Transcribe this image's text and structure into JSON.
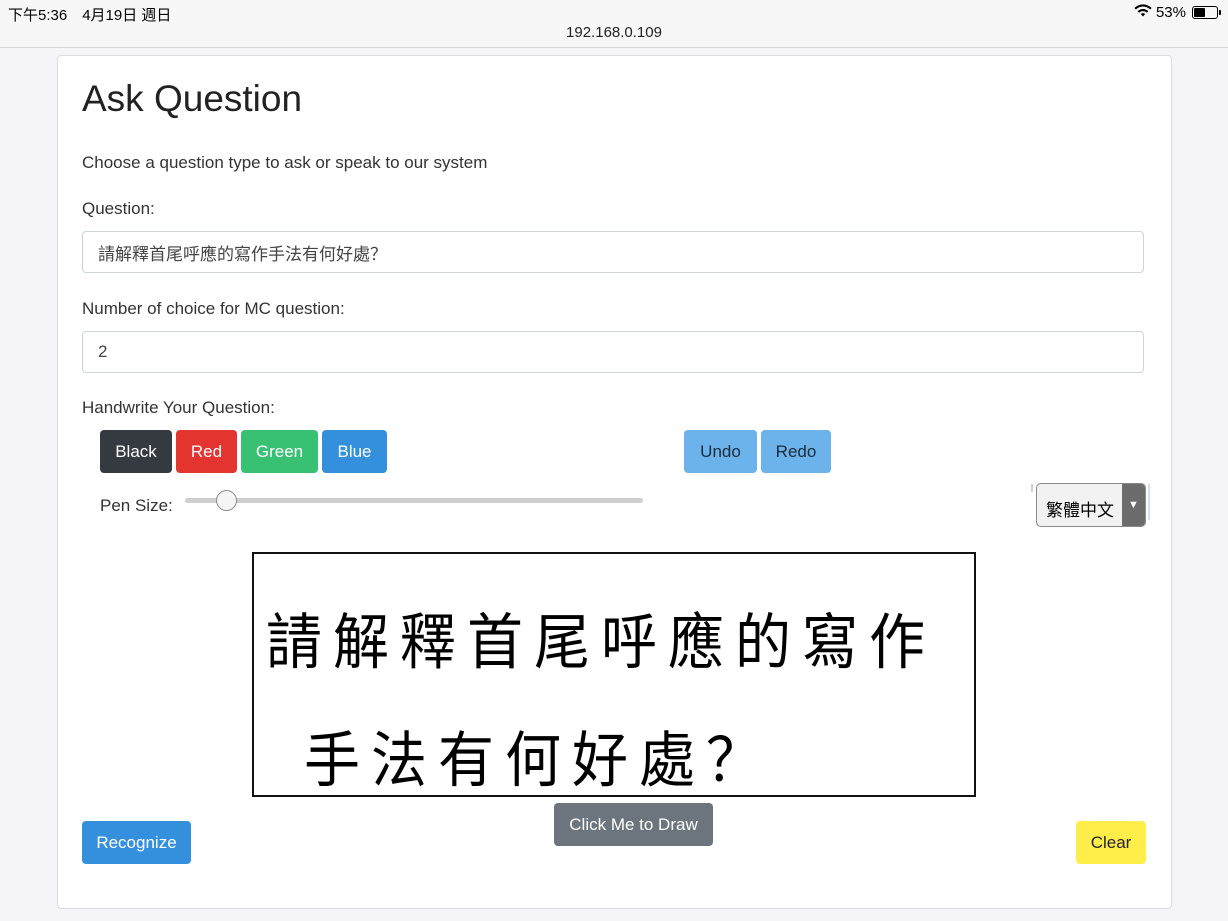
{
  "status_bar": {
    "time": "下午5:36　4月19日 週日",
    "url": "192.168.0.109",
    "battery": "53%",
    "battery_level": 0.53
  },
  "page": {
    "title": "Ask Question",
    "intro": "Choose a question type to ask or speak to our system"
  },
  "question": {
    "label": "Question:",
    "value": "請解釋首尾呼應的寫作手法有何好處？"
  },
  "mc": {
    "label": "Number of choice for MC question:",
    "value": "2"
  },
  "handwrite": {
    "label": "Handwrite Your Question:",
    "colors": [
      {
        "label": "Black",
        "bg": "#343a40",
        "fg": "#ffffff"
      },
      {
        "label": "Red",
        "bg": "#e3342f",
        "fg": "#ffffff"
      },
      {
        "label": "Green",
        "bg": "#38c172",
        "fg": "#ffffff"
      },
      {
        "label": "Blue",
        "bg": "#3490dc",
        "fg": "#ffffff"
      }
    ],
    "undo_label": "Undo",
    "redo_label": "Redo",
    "history_button_color": "#6cb2eb",
    "pen_size_label": "Pen Size:",
    "pen_size_level": 0.09,
    "language": "繁體中文",
    "ink_line1": "請解釋首尾呼應的寫作",
    "ink_line2": "手法有何好處？"
  },
  "actions": {
    "recognize_label": "Recognize",
    "draw_label": "Click Me to Draw",
    "clear_label": "Clear",
    "recognize_color": "#3490dc",
    "draw_color": "#6c757d",
    "clear_color": "#ffed4a"
  }
}
